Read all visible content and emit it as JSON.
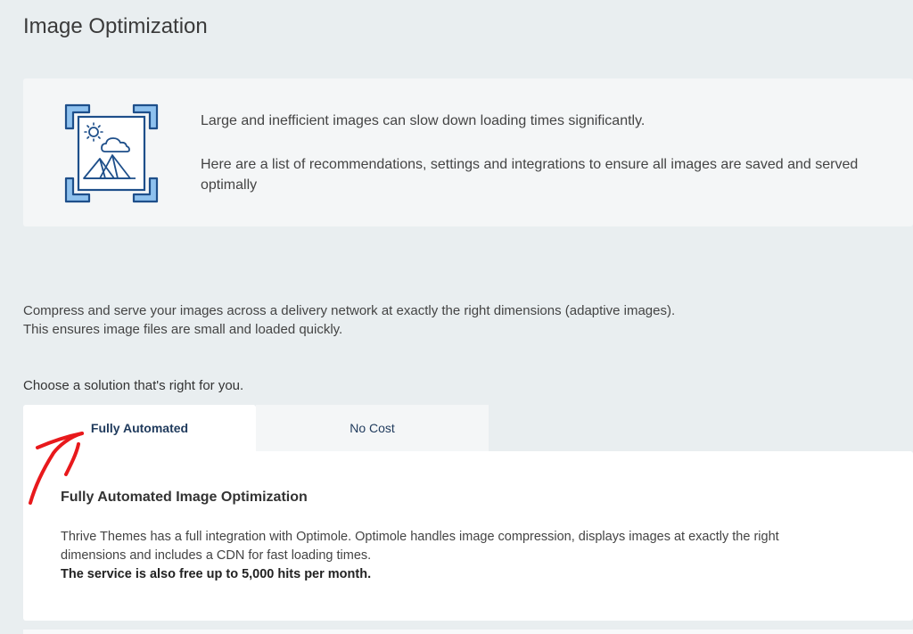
{
  "page": {
    "title": "Image Optimization"
  },
  "intro": {
    "icon": "image-optimize-icon",
    "line1": "Large and inefficient images can slow down loading times significantly.",
    "line2": "Here are a list of recommendations, settings and integrations to ensure all images are saved and served optimally"
  },
  "description": {
    "line1": "Compress and serve your images across a delivery network at exactly the right dimensions (adaptive images).",
    "line2": "This ensures image files are small and loaded quickly."
  },
  "choose_label": "Choose a solution that's right for you.",
  "tabs": [
    {
      "label": "Fully Automated",
      "active": true
    },
    {
      "label": "No Cost",
      "active": false
    }
  ],
  "panel": {
    "title": "Fully Automated Image Optimization",
    "body": "Thrive Themes has a full integration with Optimole. Optimole handles image compression, displays images at exactly the right dimensions and includes a CDN for fast loading times.",
    "highlight": "The service is also free up to 5,000 hits per month."
  },
  "colors": {
    "background": "#e9eef0",
    "card": "#f4f6f7",
    "tab_text": "#1f3a5c",
    "icon_blue": "#1e5b9c",
    "icon_light_blue": "#8ec1ee",
    "annotation_red": "#e8191c"
  }
}
